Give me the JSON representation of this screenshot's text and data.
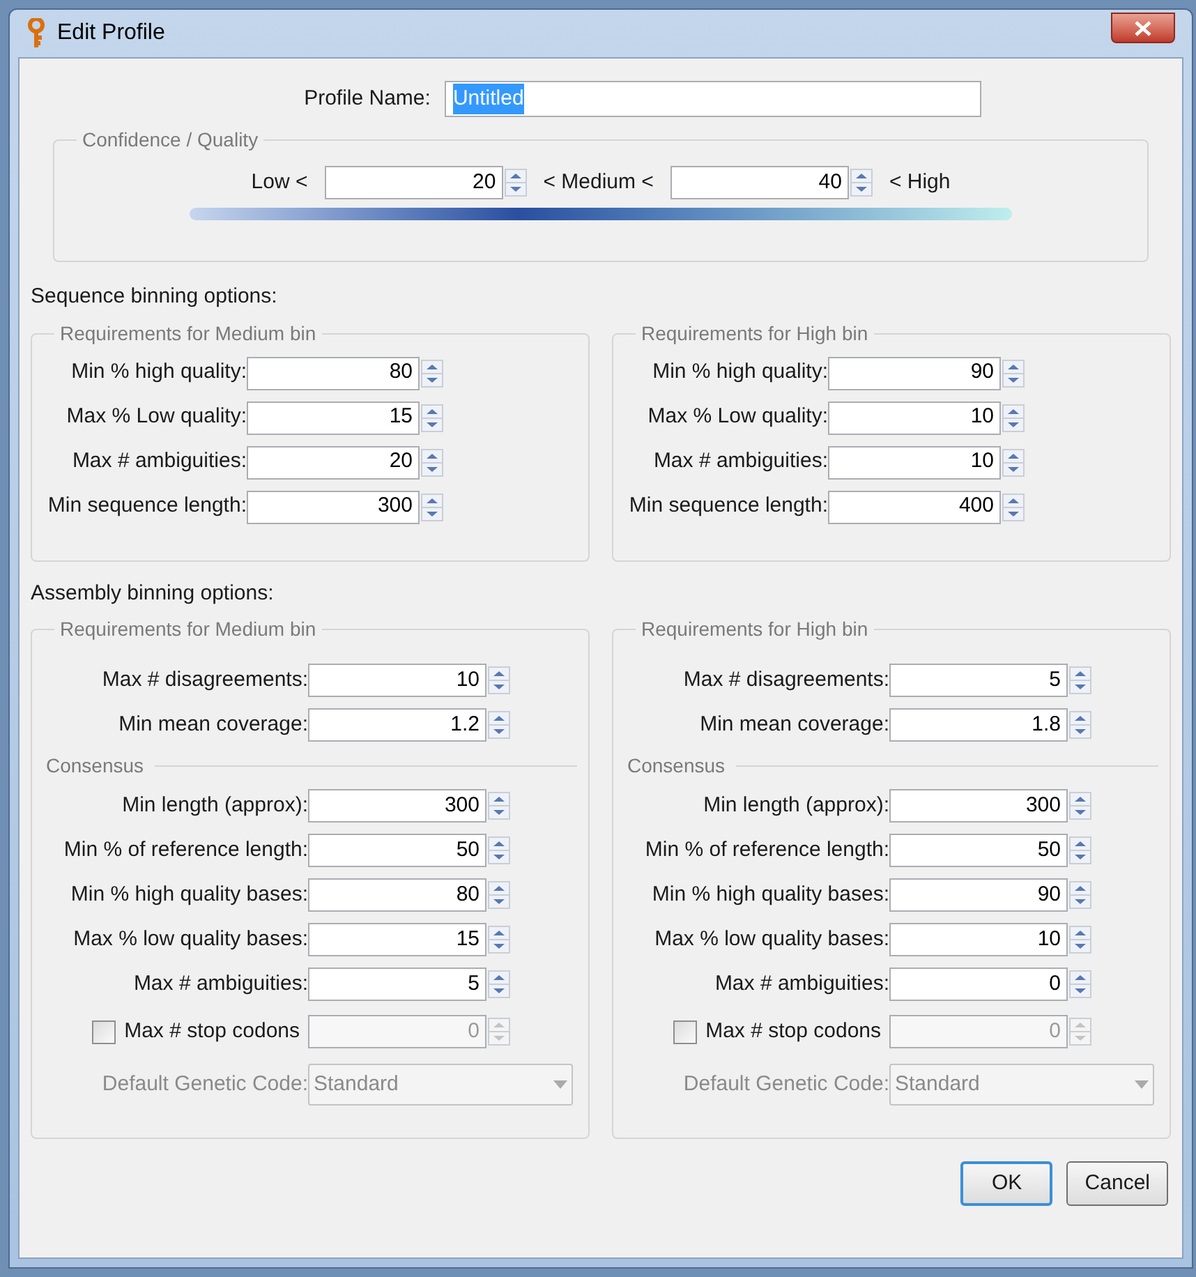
{
  "window": {
    "title": "Edit Profile"
  },
  "profile_name": {
    "label": "Profile Name:",
    "value": "Untitled",
    "selected": true
  },
  "confidence": {
    "title": "Confidence / Quality",
    "low_label": "Low <",
    "low_value": "20",
    "medium_label": "< Medium <",
    "high_value": "40",
    "high_label": "< High"
  },
  "sequence_binning": {
    "title": "Sequence binning options:",
    "groups": [
      {
        "title": "Requirements for Medium bin",
        "rows": [
          {
            "label": "Min % high quality:",
            "value": "80"
          },
          {
            "label": "Max % Low quality:",
            "value": "15"
          },
          {
            "label": "Max # ambiguities:",
            "value": "20"
          },
          {
            "label": "Min sequence length:",
            "value": "300"
          }
        ]
      },
      {
        "title": "Requirements for High bin",
        "rows": [
          {
            "label": "Min % high quality:",
            "value": "90"
          },
          {
            "label": "Max % Low quality:",
            "value": "10"
          },
          {
            "label": "Max # ambiguities:",
            "value": "10"
          },
          {
            "label": "Min sequence length:",
            "value": "400"
          }
        ]
      }
    ]
  },
  "assembly_binning": {
    "title": "Assembly binning options:",
    "groups": [
      {
        "title": "Requirements for Medium bin",
        "rows": [
          {
            "kind": "spinner",
            "label": "Max # disagreements:",
            "value": "10"
          },
          {
            "kind": "spinner",
            "label": "Min mean coverage:",
            "value": "1.2"
          },
          {
            "kind": "section",
            "label": "Consensus"
          },
          {
            "kind": "spinner",
            "label": "Min length (approx):",
            "value": "300"
          },
          {
            "kind": "spinner",
            "label": "Min % of reference length:",
            "value": "50"
          },
          {
            "kind": "spinner",
            "label": "Min % high quality bases:",
            "value": "80"
          },
          {
            "kind": "spinner",
            "label": "Max % low quality bases:",
            "value": "15"
          },
          {
            "kind": "spinner",
            "label": "Max # ambiguities:",
            "value": "5"
          },
          {
            "kind": "checkbox_spinner",
            "label": "Max # stop codons",
            "value": "0",
            "checked": false,
            "disabled": true
          },
          {
            "kind": "combo",
            "label": "Default Genetic Code:",
            "value": "Standard",
            "disabled": true
          }
        ]
      },
      {
        "title": "Requirements for High bin",
        "rows": [
          {
            "kind": "spinner",
            "label": "Max # disagreements:",
            "value": "5"
          },
          {
            "kind": "spinner",
            "label": "Min mean coverage:",
            "value": "1.8"
          },
          {
            "kind": "section",
            "label": "Consensus"
          },
          {
            "kind": "spinner",
            "label": "Min length (approx):",
            "value": "300"
          },
          {
            "kind": "spinner",
            "label": "Min % of reference length:",
            "value": "50"
          },
          {
            "kind": "spinner",
            "label": "Min % high quality bases:",
            "value": "90"
          },
          {
            "kind": "spinner",
            "label": "Max % low quality bases:",
            "value": "10"
          },
          {
            "kind": "spinner",
            "label": "Max # ambiguities:",
            "value": "0"
          },
          {
            "kind": "checkbox_spinner",
            "label": "Max # stop codons",
            "value": "0",
            "checked": false,
            "disabled": true
          },
          {
            "kind": "combo",
            "label": "Default Genetic Code:",
            "value": "Standard",
            "disabled": true
          }
        ]
      }
    ]
  },
  "buttons": [
    {
      "label": "OK",
      "default": true
    },
    {
      "label": "Cancel",
      "default": false
    }
  ]
}
